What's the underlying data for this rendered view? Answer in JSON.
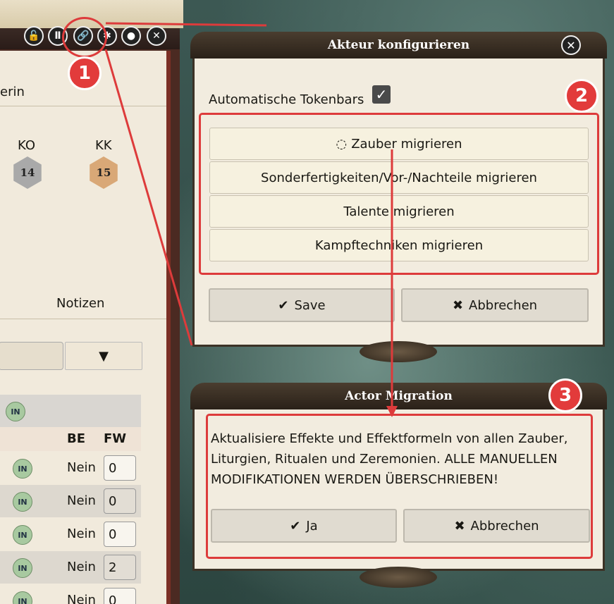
{
  "sheet": {
    "header_partial": "erin",
    "attributes": [
      {
        "label": "KO",
        "value": "14",
        "color": "#a9a9a9"
      },
      {
        "label": "KK",
        "value": "15",
        "color": "#d9a877"
      }
    ],
    "tab_notes": "Notizen",
    "table_headers": {
      "be": "BE",
      "fw": "FW"
    },
    "badge": "IN",
    "rows": [
      {
        "be": "Nein",
        "fw": "0"
      },
      {
        "be": "Nein",
        "fw": "0"
      },
      {
        "be": "Nein",
        "fw": "0"
      },
      {
        "be": "Nein",
        "fw": "2"
      },
      {
        "be": "Nein",
        "fw": "0"
      }
    ]
  },
  "config_dialog": {
    "title": "Akteur konfigurieren",
    "checkbox_label": "Automatische Tokenbars",
    "migration_buttons": [
      "Zauber migrieren",
      "Sonderfertigkeiten/Vor-/Nachteile migrieren",
      "Talente migrieren",
      "Kampftechniken migrieren"
    ],
    "save_label": "Save",
    "cancel_label": "Abbrechen"
  },
  "migration_dialog": {
    "title": "Actor Migration",
    "message": "Aktualisiere Effekte und Effektformeln von allen Zauber, Liturgien, Ritualen und Zeremonien. ALLE MANUELLEN MODIFIKATIONEN WERDEN ÜBERSCHRIEBEN!",
    "yes_label": "Ja",
    "cancel_label": "Abbrechen"
  },
  "callouts": [
    "1",
    "2",
    "3"
  ],
  "colors": {
    "callout_red": "#dd3b3b"
  }
}
